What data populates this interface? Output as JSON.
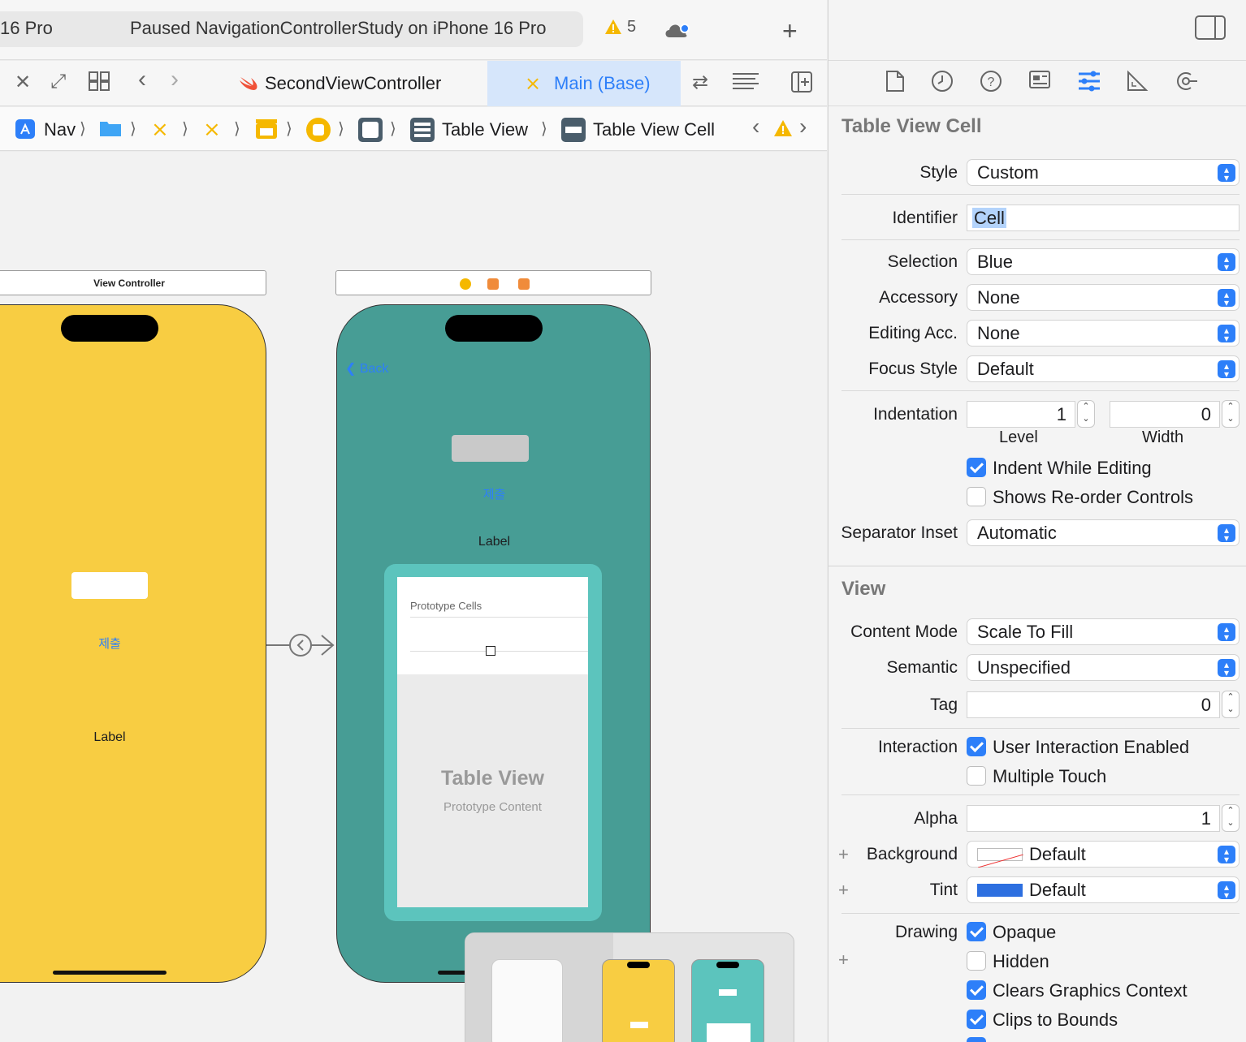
{
  "toolbar": {
    "device": "16 Pro",
    "status": "Paused NavigationControllerStudy on iPhone 16 Pro",
    "warnings": "5"
  },
  "tabs": [
    {
      "label": "SecondViewController"
    },
    {
      "label": "Main (Base)"
    }
  ],
  "breadcrumb": {
    "nav": "Nav",
    "table_view": "Table View",
    "table_view_cell": "Table View Cell"
  },
  "canvas": {
    "vc_title": "View Controller",
    "yellow_button": "제출",
    "yellow_label": "Label",
    "teal_back": "Back",
    "teal_button": "제출",
    "teal_label": "Label",
    "prototype_cells": "Prototype Cells",
    "table_view_title": "Table View",
    "table_view_subtitle": "Prototype Content"
  },
  "inspector": {
    "section_cell": "Table View Cell",
    "style_label": "Style",
    "style_value": "Custom",
    "identifier_label": "Identifier",
    "identifier_value": "Cell",
    "selection_label": "Selection",
    "selection_value": "Blue",
    "accessory_label": "Accessory",
    "accessory_value": "None",
    "editing_acc_label": "Editing Acc.",
    "editing_acc_value": "None",
    "focus_label": "Focus Style",
    "focus_value": "Default",
    "indentation_label": "Indentation",
    "level_value": "1",
    "width_value": "0",
    "level_caption": "Level",
    "width_caption": "Width",
    "indent_while_editing": "Indent While Editing",
    "shows_reorder": "Shows Re-order Controls",
    "separator_label": "Separator Inset",
    "separator_value": "Automatic",
    "section_view": "View",
    "content_mode_label": "Content Mode",
    "content_mode_value": "Scale To Fill",
    "semantic_label": "Semantic",
    "semantic_value": "Unspecified",
    "tag_label": "Tag",
    "tag_value": "0",
    "interaction_label": "Interaction",
    "user_interaction": "User Interaction Enabled",
    "multiple_touch": "Multiple Touch",
    "alpha_label": "Alpha",
    "alpha_value": "1",
    "background_label": "Background",
    "background_value": "Default",
    "tint_label": "Tint",
    "tint_value": "Default",
    "drawing_label": "Drawing",
    "opaque": "Opaque",
    "hidden": "Hidden",
    "clears_context": "Clears Graphics Context",
    "clips_bounds": "Clips to Bounds"
  },
  "colors": {
    "accent": "#2d7ff9",
    "yellow_vc": "#f8cd42",
    "teal_vc": "#479d95",
    "teal_light": "#5cc4bd"
  }
}
